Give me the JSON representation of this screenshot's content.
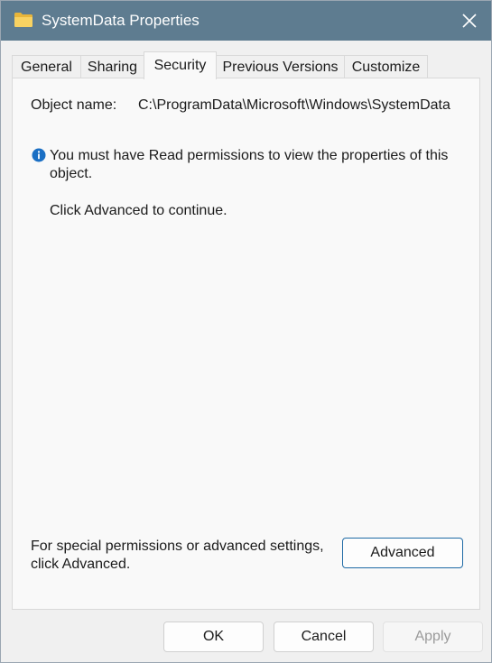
{
  "window": {
    "title": "SystemData Properties",
    "folder_icon": "folder-icon",
    "close_icon": "close-icon"
  },
  "tabs": [
    {
      "label": "General",
      "active": false
    },
    {
      "label": "Sharing",
      "active": false
    },
    {
      "label": "Security",
      "active": true
    },
    {
      "label": "Previous Versions",
      "active": false
    },
    {
      "label": "Customize",
      "active": false
    }
  ],
  "security": {
    "object_name_label": "Object name:",
    "object_name_value": "C:\\ProgramData\\Microsoft\\Windows\\SystemData",
    "info_icon": "info-icon",
    "message": "You must have Read permissions to view the properties of this object.",
    "instruction": "Click Advanced to continue.",
    "advanced_hint": "For special permissions or advanced settings, click Advanced.",
    "advanced_button": "Advanced"
  },
  "buttons": {
    "ok": "OK",
    "cancel": "Cancel",
    "apply": "Apply"
  },
  "colors": {
    "titlebar": "#5e7c90",
    "accent": "#1f6aa5",
    "info": "#1a6fc4"
  }
}
